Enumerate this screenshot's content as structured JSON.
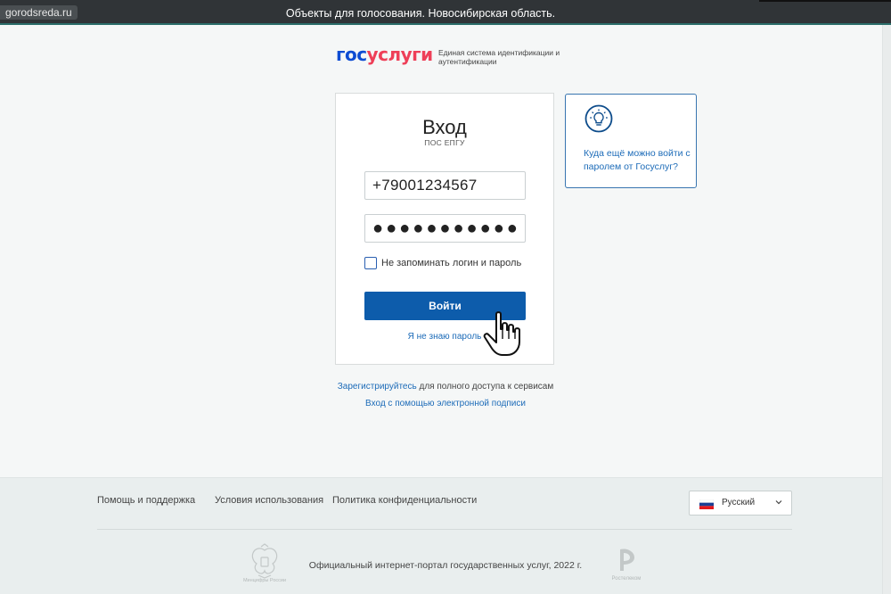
{
  "browser": {
    "url": "gorodsreda.ru",
    "page_title": "Объекты для голосования. Новосибирская область."
  },
  "logo": {
    "word_part1": "гос",
    "word_part2": "услуги",
    "subtitle": "Единая система идентификации и аутентификации"
  },
  "login": {
    "heading": "Вход",
    "subheading": "ПОС ЕПГУ",
    "phone_value": "+79001234567",
    "password_mask": "●●●●●●●●●●●●",
    "remember_label": "Не запоминать логин и пароль",
    "remember_checked": false,
    "submit_label": "Войти",
    "forgot_label": "Я не знаю пароль"
  },
  "hint": {
    "icon": "lightbulb-icon",
    "text": "Куда ещё можно войти с паролем от Госуслуг?"
  },
  "links": {
    "register_link": "Зарегистрируйтесь",
    "register_rest": " для полного доступа к сервисам",
    "esign": "Вход с помощью электронной подписи"
  },
  "footer": {
    "nav": [
      "Помощь и поддержка",
      "Условия использования",
      "Политика конфиденциальности"
    ],
    "language": "Русский",
    "copyright": "Официальный интернет-портал государственных услуг, 2022 г.",
    "emblem_caption": "Минцифры России",
    "operator_caption": "Ростелеком"
  },
  "colors": {
    "primary_button": "#0d5cab",
    "link": "#1c6bb8",
    "logo_blue": "#0d4cd3",
    "logo_red": "#ee3f58"
  }
}
